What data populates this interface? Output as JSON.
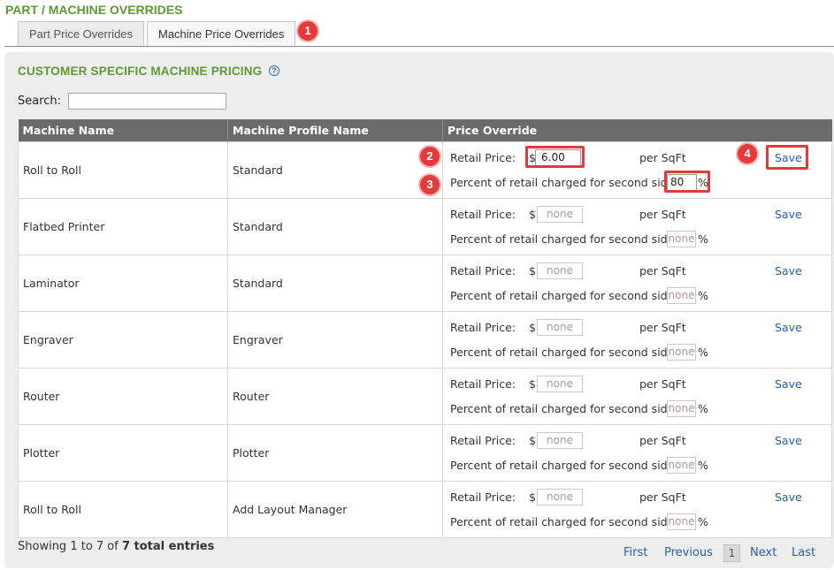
{
  "page_title": "PART / MACHINE OVERRIDES",
  "tabs": [
    {
      "label": "Part Price Overrides",
      "active": false
    },
    {
      "label": "Machine Price Overrides",
      "active": true
    }
  ],
  "section_title": "CUSTOMER SPECIFIC MACHINE PRICING",
  "help_icon": "?",
  "search": {
    "label": "Search:",
    "value": ""
  },
  "table": {
    "headers": [
      "Machine Name",
      "Machine Profile Name",
      "Price Override"
    ],
    "retail_label": "Retail Price:",
    "currency": "$",
    "per_unit": "per SqFt",
    "second_side_label": "Percent of retail charged for second side:",
    "percent_sign": "%",
    "save_label": "Save",
    "rows": [
      {
        "machine": "Roll to Roll",
        "profile": "Standard",
        "price": "6.00",
        "percent": "80"
      },
      {
        "machine": "Flatbed Printer",
        "profile": "Standard",
        "price": "none",
        "percent": "none"
      },
      {
        "machine": "Laminator",
        "profile": "Standard",
        "price": "none",
        "percent": "none"
      },
      {
        "machine": "Engraver",
        "profile": "Engraver",
        "price": "none",
        "percent": "none"
      },
      {
        "machine": "Router",
        "profile": "Router",
        "price": "none",
        "percent": "none"
      },
      {
        "machine": "Plotter",
        "profile": "Plotter",
        "price": "none",
        "percent": "none"
      },
      {
        "machine": "Roll to Roll",
        "profile": "Add Layout Manager",
        "price": "none",
        "percent": "none"
      }
    ]
  },
  "footer": {
    "showing_prefix": "Showing 1 to 7 of ",
    "showing_total": "7 total entries"
  },
  "pagination": {
    "first": "First",
    "previous": "Previous",
    "current": "1",
    "next": "Next",
    "last": "Last"
  },
  "annotations": [
    "1",
    "2",
    "3",
    "4"
  ],
  "colors": {
    "brand_green": "#5e9a32",
    "header_gray": "#6b6b6b",
    "link_blue": "#2a5ea8",
    "annotation_red": "#e23a3a"
  }
}
